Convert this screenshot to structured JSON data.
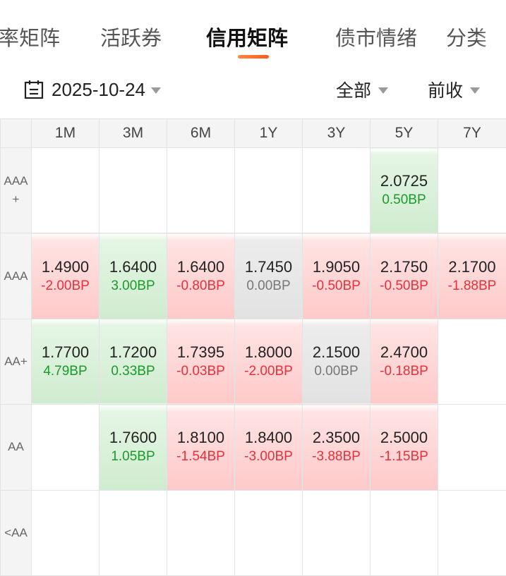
{
  "tabs": [
    {
      "label": "率矩阵",
      "active": false
    },
    {
      "label": "活跃券",
      "active": false
    },
    {
      "label": "信用矩阵",
      "active": true
    },
    {
      "label": "债市情绪",
      "active": false
    },
    {
      "label": "分类",
      "active": false
    }
  ],
  "toolbar": {
    "date": "2025-10-24",
    "scope_filter": "全部",
    "close_filter": "前收",
    "icons": {
      "date": "calendar-icon",
      "dropdown": "caret-down-icon"
    }
  },
  "matrix": {
    "columns": [
      "1M",
      "3M",
      "6M",
      "1Y",
      "3Y",
      "5Y",
      "7Y"
    ],
    "rows": [
      {
        "label": "AAA\n+",
        "cells": [
          null,
          null,
          null,
          null,
          null,
          {
            "yield": "2.0725",
            "change": "0.50BP",
            "trend": "down"
          },
          null
        ]
      },
      {
        "label": "AAA",
        "cells": [
          {
            "yield": "1.4900",
            "change": "-2.00BP",
            "trend": "up"
          },
          {
            "yield": "1.6400",
            "change": "3.00BP",
            "trend": "down"
          },
          {
            "yield": "1.6400",
            "change": "-0.80BP",
            "trend": "up"
          },
          {
            "yield": "1.7450",
            "change": "0.00BP",
            "trend": "flat"
          },
          {
            "yield": "1.9050",
            "change": "-0.50BP",
            "trend": "up"
          },
          {
            "yield": "2.1750",
            "change": "-0.50BP",
            "trend": "up"
          },
          {
            "yield": "2.1700",
            "change": "-1.88BP",
            "trend": "up"
          }
        ]
      },
      {
        "label": "AA+",
        "cells": [
          {
            "yield": "1.7700",
            "change": "4.79BP",
            "trend": "down"
          },
          {
            "yield": "1.7200",
            "change": "0.33BP",
            "trend": "down"
          },
          {
            "yield": "1.7395",
            "change": "-0.03BP",
            "trend": "up"
          },
          {
            "yield": "1.8000",
            "change": "-2.00BP",
            "trend": "up"
          },
          {
            "yield": "2.1500",
            "change": "0.00BP",
            "trend": "flat"
          },
          {
            "yield": "2.4700",
            "change": "-0.18BP",
            "trend": "up"
          },
          null
        ]
      },
      {
        "label": "AA",
        "cells": [
          null,
          {
            "yield": "1.7600",
            "change": "1.05BP",
            "trend": "down"
          },
          {
            "yield": "1.8100",
            "change": "-1.54BP",
            "trend": "up"
          },
          {
            "yield": "1.8400",
            "change": "-3.00BP",
            "trend": "up"
          },
          {
            "yield": "2.3500",
            "change": "-3.88BP",
            "trend": "up"
          },
          {
            "yield": "2.5000",
            "change": "-1.15BP",
            "trend": "up"
          },
          null
        ]
      },
      {
        "label": "<AA",
        "cells": [
          null,
          null,
          null,
          null,
          null,
          null,
          null
        ]
      }
    ],
    "colors": {
      "red": "#e8313b",
      "green": "#1a9a2a",
      "neutral": "#777777",
      "accent": "#ff5a1f"
    }
  }
}
